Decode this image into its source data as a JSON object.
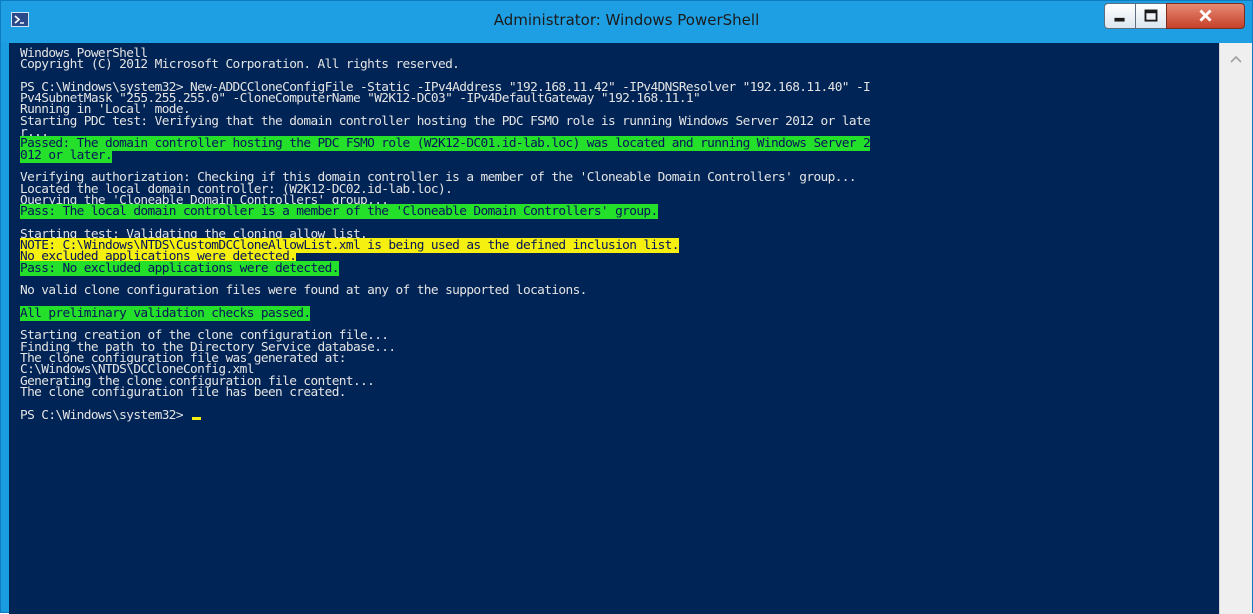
{
  "window": {
    "title": "Administrator: Windows PowerShell",
    "icon": "powershell-icon",
    "controls": [
      "minimize-icon",
      "maximize-icon",
      "close-icon"
    ]
  },
  "colors": {
    "console_bg": "#012456",
    "console_fg": "#e4e4e4",
    "titlebar": "#1e9fe3",
    "highlight_green": "#24e02a",
    "highlight_yellow": "#f5f010"
  },
  "console": {
    "lines": [
      {
        "text": "Windows PowerShell",
        "hl": ""
      },
      {
        "text": "Copyright (C) 2012 Microsoft Corporation. All rights reserved.",
        "hl": ""
      },
      {
        "text": "",
        "hl": ""
      },
      {
        "text": "PS C:\\Windows\\system32> New-ADDCCloneConfigFile -Static -IPv4Address \"192.168.11.42\" -IPv4DNSResolver \"192.168.11.40\" -I",
        "hl": ""
      },
      {
        "text": "Pv4SubnetMask \"255.255.255.0\" -CloneComputerName \"W2K12-DC03\" -IPv4DefaultGateway \"192.168.11.1\"",
        "hl": ""
      },
      {
        "text": "Running in 'Local' mode.",
        "hl": ""
      },
      {
        "text": "Starting PDC test: Verifying that the domain controller hosting the PDC FSMO role is running Windows Server 2012 or late",
        "hl": ""
      },
      {
        "text": "r...",
        "hl": ""
      },
      {
        "text": "Passed: The domain controller hosting the PDC FSMO role (W2K12-DC01.id-lab.loc) was located and running Windows Server 2",
        "hl": "green"
      },
      {
        "text": "012 or later.",
        "hl": "green"
      },
      {
        "text": "",
        "hl": ""
      },
      {
        "text": "Verifying authorization: Checking if this domain controller is a member of the 'Cloneable Domain Controllers' group...",
        "hl": ""
      },
      {
        "text": "Located the local domain controller: (W2K12-DC02.id-lab.loc).",
        "hl": ""
      },
      {
        "text": "Querying the 'Cloneable Domain Controllers' group...",
        "hl": ""
      },
      {
        "text": "Pass: The local domain controller is a member of the 'Cloneable Domain Controllers' group.",
        "hl": "green"
      },
      {
        "text": "",
        "hl": ""
      },
      {
        "text": "Starting test: Validating the cloning allow list.",
        "hl": ""
      },
      {
        "text": "NOTE: C:\\Windows\\NTDS\\CustomDCCloneAllowList.xml is being used as the defined inclusion list.",
        "hl": "yellow"
      },
      {
        "text": "No excluded applications were detected.",
        "hl": "yellow"
      },
      {
        "text": "Pass: No excluded applications were detected.",
        "hl": "green"
      },
      {
        "text": "",
        "hl": ""
      },
      {
        "text": "No valid clone configuration files were found at any of the supported locations.",
        "hl": ""
      },
      {
        "text": "",
        "hl": ""
      },
      {
        "text": "All preliminary validation checks passed.",
        "hl": "green"
      },
      {
        "text": "",
        "hl": ""
      },
      {
        "text": "Starting creation of the clone configuration file...",
        "hl": ""
      },
      {
        "text": "Finding the path to the Directory Service database...",
        "hl": ""
      },
      {
        "text": "The clone configuration file was generated at:",
        "hl": ""
      },
      {
        "text": "C:\\Windows\\NTDS\\DCCloneConfig.xml",
        "hl": ""
      },
      {
        "text": "Generating the clone configuration file content...",
        "hl": ""
      },
      {
        "text": "The clone configuration file has been created.",
        "hl": ""
      },
      {
        "text": "",
        "hl": ""
      },
      {
        "text": "PS C:\\Windows\\system32> ",
        "hl": "",
        "cursor": true
      }
    ]
  },
  "scrollbar": {
    "up_icon": "scroll-up-arrow-icon"
  }
}
